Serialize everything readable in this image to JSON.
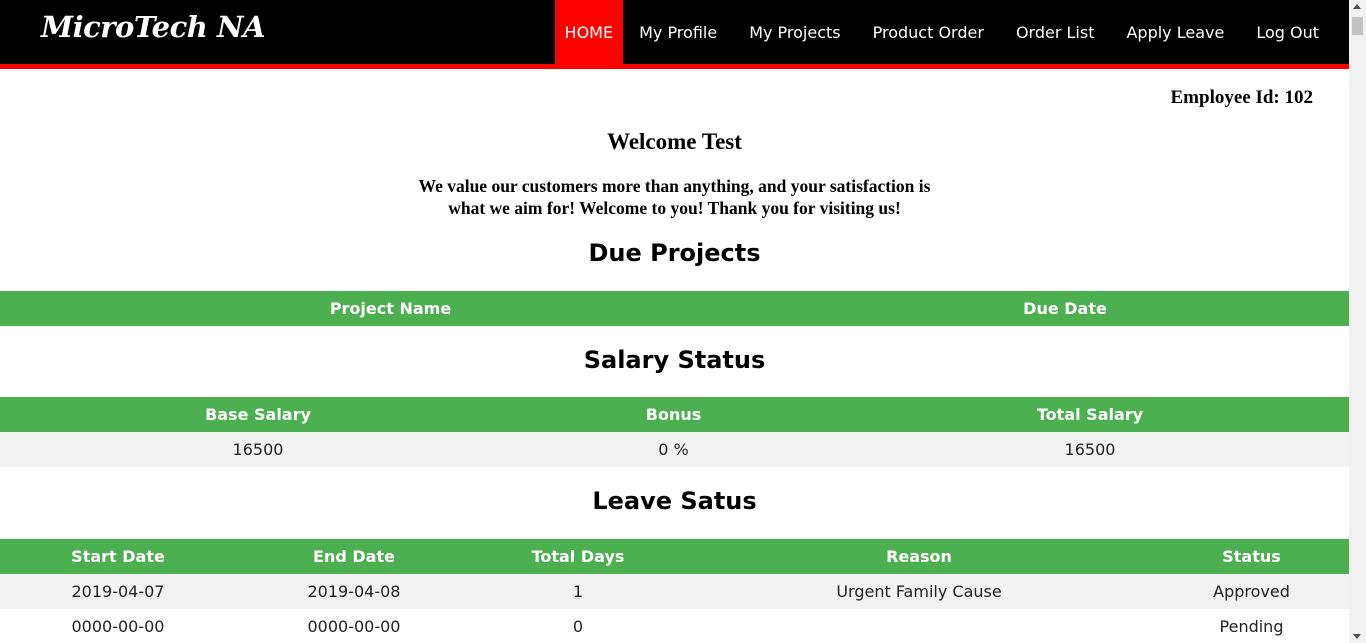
{
  "brand": "MicroTech NA",
  "nav": {
    "home": "HOME",
    "my_profile": "My Profile",
    "my_projects": "My Projects",
    "product_order": "Product Order",
    "order_list": "Order List",
    "apply_leave": "Apply Leave",
    "log_out": "Log Out"
  },
  "employee_id": "Employee Id: 102",
  "welcome": "Welcome Test",
  "intro": "We value our customers more than anything, and your satisfaction is what we aim for! Welcome to you! Thank you for visiting us!",
  "due_projects": {
    "title": "Due Projects",
    "headers": [
      "Project Name",
      "Due Date"
    ]
  },
  "salary": {
    "title": "Salary Status",
    "headers": [
      "Base Salary",
      "Bonus",
      "Total Salary"
    ],
    "rows": [
      [
        "16500",
        "0 %",
        "16500"
      ]
    ]
  },
  "leave": {
    "title": "Leave Satus",
    "headers": [
      "Start Date",
      "End Date",
      "Total Days",
      "Reason",
      "Status"
    ],
    "rows": [
      [
        "2019-04-07",
        "2019-04-08",
        "1",
        "Urgent Family Cause",
        "Approved"
      ],
      [
        "0000-00-00",
        "0000-00-00",
        "0",
        "",
        "Pending"
      ]
    ]
  },
  "colors": {
    "navbar": "#000000",
    "accent": "#ff0000",
    "table_header": "#4caf50",
    "row_stripe": "#f2f2f2"
  }
}
